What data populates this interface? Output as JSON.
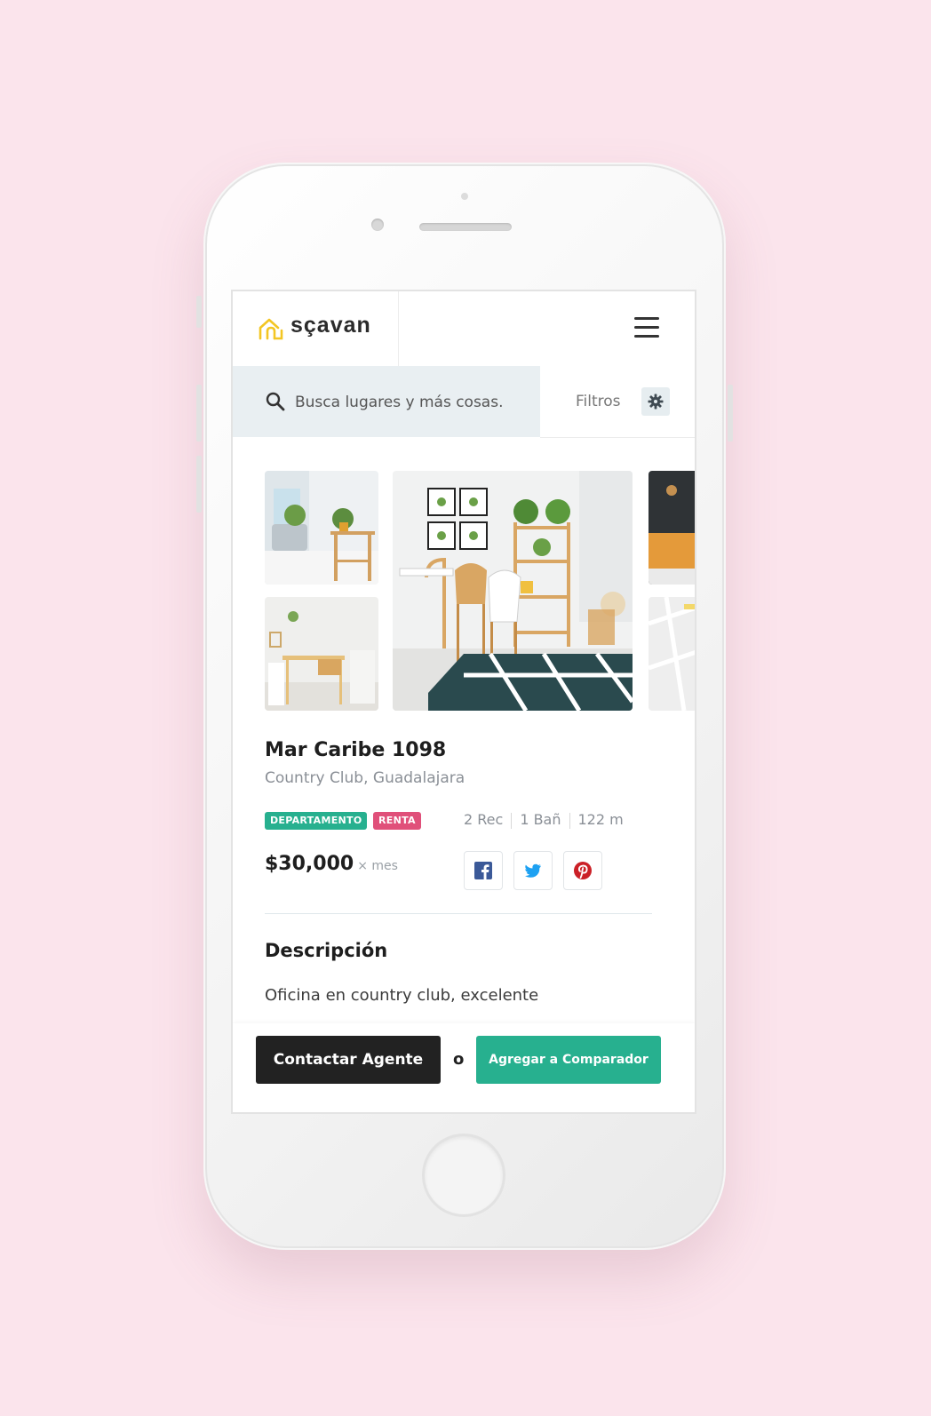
{
  "app": {
    "name": "sçavan"
  },
  "search": {
    "placeholder": "Busca lugares y más cosas.",
    "filters_label": "Filtros"
  },
  "property": {
    "title": "Mar Caribe 1098",
    "location": "Country Club, Guadalajara",
    "badges": [
      {
        "label": "DEPARTAMENTO",
        "color": "#27b08f"
      },
      {
        "label": "RENTA",
        "color": "#e0507a"
      }
    ],
    "specs": {
      "rooms": "2 Rec",
      "baths": "1 Bañ",
      "area": "122 m"
    },
    "price": "$30,000",
    "price_unit": "× mes",
    "description_title": "Descripción",
    "description": "Oficina en country club, excelente"
  },
  "share": {
    "icons": [
      "facebook-icon",
      "twitter-icon",
      "pinterest-icon"
    ]
  },
  "actions": {
    "contact_label": "Contactar Agente",
    "or_label": "o",
    "compare_label": "Agregar a Comparador"
  },
  "colors": {
    "background": "#fbe4ec",
    "accent": "#27b08f",
    "rent": "#e0507a",
    "logo": "#f3c623"
  }
}
